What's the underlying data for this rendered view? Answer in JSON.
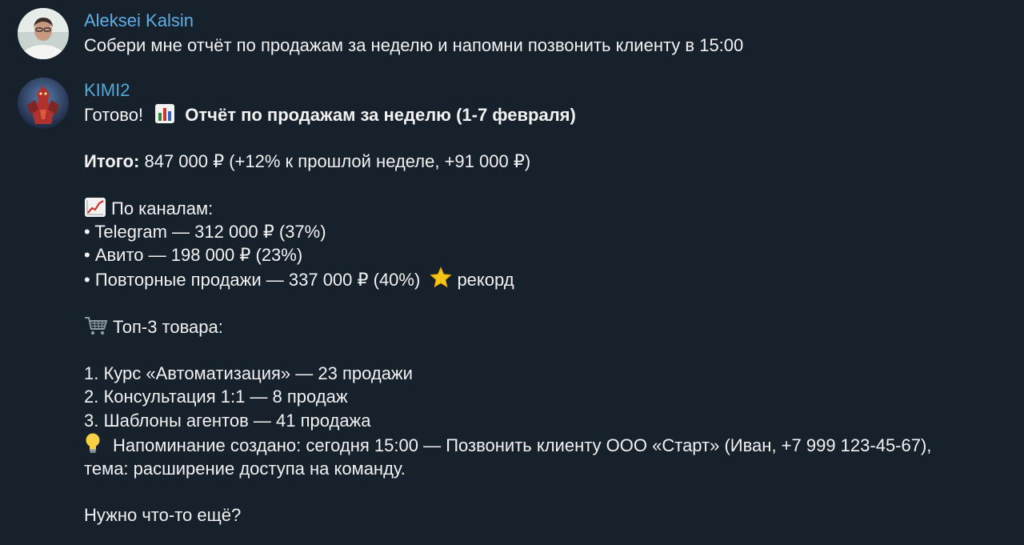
{
  "messages": {
    "user": {
      "author": "Aleksei Kalsin",
      "text": "Собери мне отчёт по продажам за неделю и напомни позвонить клиенту в 15:00"
    },
    "bot": {
      "author": "KIMI2",
      "greeting": "Готово!",
      "report_title": "Отчёт по продажам за неделю (1-7 февраля)",
      "total_label": "Итого:",
      "total_value": " 847 000 ₽ (+12% к прошлой неделе, +91 000 ₽)",
      "channels_heading": "По каналам:",
      "channels": [
        "• Telegram — 312 000 ₽ (37%)",
        "• Авито — 198 000 ₽ (23%)",
        "• Повторные продажи — 337 000 ₽ (40%)"
      ],
      "record_label": "рекорд",
      "products_heading": "Топ-3 товара:",
      "products": [
        "1. Курс «Автоматизация» — 23 продажи",
        "2. Консультация 1:1 — 8 продаж",
        "3. Шаблоны агентов — 41 продажа"
      ],
      "reminder": "Напоминание создано: сегодня 15:00 — Позвонить клиенту ООО «Старт» (Иван, +7 999 123-45-67), тема: расширение доступа на команду.",
      "closing": "Нужно что-то ещё?"
    }
  },
  "icons": {
    "chart": "bar-chart-icon",
    "trend": "chart-increasing-icon",
    "star": "star-icon",
    "cart": "shopping-cart-icon",
    "bulb": "light-bulb-icon"
  },
  "colors": {
    "background": "#17212b",
    "user_name": "#5eaee8",
    "bot_name": "#53a9d6",
    "text": "#f2f2f2"
  }
}
